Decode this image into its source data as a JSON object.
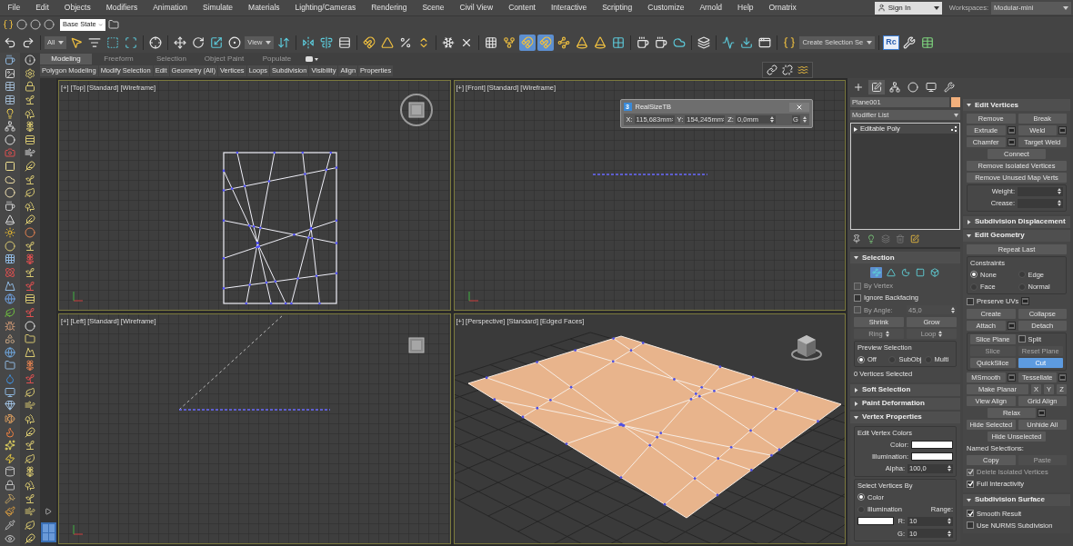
{
  "menu": [
    "File",
    "Edit",
    "Objects",
    "Modifiers",
    "Animation",
    "Simulate",
    "Materials",
    "Lighting/Cameras",
    "Rendering",
    "Scene",
    "Civil View",
    "Content",
    "Interactive",
    "Scripting",
    "Customize",
    "Arnold",
    "Help",
    "Ornatrix"
  ],
  "sign_in": "Sign In",
  "workspaces_label": "Workspaces:",
  "workspace": "Modular-mini",
  "state_set": "Base State",
  "main_toolbar": [
    {
      "kind": "tool",
      "selected": false
    },
    {
      "kind": "tool",
      "selected": false
    },
    {
      "kind": "sep"
    },
    {
      "kind": "dropdown",
      "value": "All"
    },
    {
      "kind": "tool",
      "selected": false
    },
    {
      "kind": "tool",
      "selected": false
    },
    {
      "kind": "tool",
      "selected": false
    },
    {
      "kind": "tool",
      "selected": false
    },
    {
      "kind": "sep"
    },
    {
      "kind": "tool",
      "selected": false
    },
    {
      "kind": "sep"
    },
    {
      "kind": "tool",
      "selected": false
    },
    {
      "kind": "tool",
      "selected": false
    },
    {
      "kind": "tool",
      "selected": false
    },
    {
      "kind": "tool",
      "selected": false
    },
    {
      "kind": "dropdown",
      "value": "View"
    },
    {
      "kind": "tool",
      "selected": false
    },
    {
      "kind": "sep"
    },
    {
      "kind": "tool",
      "selected": false
    },
    {
      "kind": "tool",
      "selected": false
    },
    {
      "kind": "tool",
      "selected": false
    },
    {
      "kind": "sep"
    },
    {
      "kind": "tool",
      "selected": false
    },
    {
      "kind": "tool",
      "selected": false
    },
    {
      "kind": "tool",
      "selected": false
    },
    {
      "kind": "tool",
      "selected": false
    },
    {
      "kind": "sep"
    },
    {
      "kind": "tool",
      "selected": false
    },
    {
      "kind": "tool",
      "selected": false
    },
    {
      "kind": "sep"
    },
    {
      "kind": "tool",
      "selected": false
    },
    {
      "kind": "tool",
      "selected": false
    },
    {
      "kind": "tool",
      "selected": true
    },
    {
      "kind": "tool",
      "selected": true
    },
    {
      "kind": "tool",
      "selected": false
    },
    {
      "kind": "tool",
      "selected": false
    },
    {
      "kind": "tool",
      "selected": false
    },
    {
      "kind": "tool",
      "selected": false
    },
    {
      "kind": "sep"
    },
    {
      "kind": "tool",
      "selected": false
    },
    {
      "kind": "tool",
      "selected": false
    },
    {
      "kind": "tool",
      "selected": false
    },
    {
      "kind": "sep"
    },
    {
      "kind": "tool",
      "selected": false
    },
    {
      "kind": "sep"
    },
    {
      "kind": "tool",
      "selected": false
    },
    {
      "kind": "tool",
      "selected": false
    },
    {
      "kind": "tool",
      "selected": false
    },
    {
      "kind": "sep"
    },
    {
      "kind": "tool",
      "selected": false
    },
    {
      "kind": "dropdown",
      "value": "Create Selection Se"
    },
    {
      "kind": "sep"
    },
    {
      "kind": "badge",
      "label": "Rc"
    },
    {
      "kind": "tool",
      "selected": false
    },
    {
      "kind": "tool",
      "selected": false
    }
  ],
  "ribbon_tabs": [
    {
      "label": "Modeling",
      "selected": true
    },
    {
      "label": "Freeform",
      "selected": false
    },
    {
      "label": "Selection",
      "selected": false
    },
    {
      "label": "Object Paint",
      "selected": false
    },
    {
      "label": "Populate",
      "selected": false
    }
  ],
  "ribbon_groups": [
    "Polygon Modeling",
    "Modify Selection",
    "Edit",
    "Geometry (All)",
    "Vertices",
    "Loops",
    "Subdivision",
    "Visibility",
    "Align",
    "Properties"
  ],
  "viewports": [
    {
      "kind": "top",
      "labels": [
        "[+]",
        "[Top]",
        "[Standard]",
        "[Wireframe]"
      ]
    },
    {
      "kind": "front",
      "labels": [
        "[+]",
        "[Front]",
        "[Standard]",
        "[Wireframe]"
      ]
    },
    {
      "kind": "left",
      "labels": [
        "[+]",
        "[Left]",
        "[Standard]",
        "[Wireframe]"
      ]
    },
    {
      "kind": "perspective",
      "labels": [
        "[+]",
        "[Perspective]",
        "[Standard]",
        "[Edged Faces]"
      ]
    }
  ],
  "realsize": {
    "badge": "3",
    "title": "RealSizeTB",
    "fields": [
      {
        "label": "X:",
        "value": "115,683mm"
      },
      {
        "label": "Y:",
        "value": "154,245mm"
      },
      {
        "label": "Z:",
        "value": "0,0mm"
      }
    ],
    "g": "G"
  },
  "command_panel": {
    "tabs": [
      {
        "selected": false
      },
      {
        "selected": true
      },
      {
        "selected": false
      },
      {
        "selected": false
      },
      {
        "selected": false
      },
      {
        "selected": false
      }
    ],
    "object_name": "Plane001",
    "modifier_list": "Modifier List",
    "stack": [
      {
        "label": "Editable Poly"
      }
    ],
    "left_rollouts": [
      {
        "title": "Selection",
        "expanded": true,
        "rows": [
          [
            {
              "kind": "subobjects",
              "items": [
                {
                  "selected": true
                },
                {
                  "selected": false
                },
                {
                  "selected": false
                },
                {
                  "selected": false
                },
                {
                  "selected": false
                }
              ]
            }
          ],
          [
            {
              "kind": "check",
              "label": "By Vertex",
              "checked": false,
              "disabled": true
            }
          ],
          [
            {
              "kind": "check",
              "label": "Ignore Backfacing",
              "checked": false,
              "disabled": false
            }
          ],
          [
            {
              "kind": "check",
              "label": "By Angle:",
              "checked": false,
              "disabled": true
            },
            {
              "kind": "spinner",
              "value": "45,0",
              "disabled": true
            }
          ],
          [
            {
              "kind": "button",
              "label": "Shrink",
              "disabled": false,
              "selected": false
            },
            {
              "kind": "button",
              "label": "Grow",
              "disabled": false,
              "selected": false
            }
          ],
          [
            {
              "kind": "button",
              "label": "Ring",
              "disabled": true,
              "selected": false,
              "stepper": true
            },
            {
              "kind": "button",
              "label": "Loop",
              "disabled": true,
              "selected": false,
              "stepper": true
            }
          ],
          [
            {
              "kind": "group",
              "title": "Preview Selection",
              "rows": [
                [
                  {
                    "kind": "radio",
                    "label": "Off",
                    "selected": true
                  },
                  {
                    "kind": "radio",
                    "label": "SubObj",
                    "selected": false
                  },
                  {
                    "kind": "radio",
                    "label": "Multi",
                    "selected": false
                  }
                ]
              ]
            }
          ],
          [
            {
              "kind": "text",
              "label": "0 Vertices Selected"
            }
          ]
        ]
      },
      {
        "title": "Soft Selection",
        "expanded": false
      },
      {
        "title": "Paint Deformation",
        "expanded": false
      },
      {
        "title": "Vertex Properties",
        "expanded": true,
        "rows": [
          [
            {
              "kind": "group",
              "title": "Edit Vertex Colors",
              "rows": [
                [
                  {
                    "kind": "swatch",
                    "label": "Color:"
                  }
                ],
                [
                  {
                    "kind": "swatch",
                    "label": "Illumination:"
                  }
                ],
                [
                  {
                    "kind": "spinner",
                    "label": "Alpha:",
                    "value": "100,0",
                    "disabled": false
                  }
                ]
              ]
            }
          ],
          [
            {
              "kind": "group",
              "title": "Select Vertices By",
              "rows": [
                [
                  {
                    "kind": "radio",
                    "label": "Color",
                    "selected": true
                  }
                ],
                [
                  {
                    "kind": "radio",
                    "label": "Illumination",
                    "selected": false
                  },
                  {
                    "kind": "text",
                    "label": "Range:"
                  }
                ],
                [
                  {
                    "kind": "swatch"
                  },
                  {
                    "kind": "spinner",
                    "label": "R:",
                    "value": "10",
                    "disabled": false
                  }
                ],
                [
                  {
                    "kind": "spinner",
                    "label": "G:",
                    "value": "10",
                    "disabled": false
                  }
                ]
              ]
            }
          ]
        ]
      }
    ],
    "right_rollouts": [
      {
        "title": "Edit Vertices",
        "expanded": true,
        "rows": [
          [
            {
              "kind": "button",
              "label": "Remove",
              "disabled": false,
              "selected": false
            },
            {
              "kind": "button",
              "label": "Break",
              "disabled": false,
              "selected": false
            }
          ],
          [
            {
              "kind": "button",
              "label": "Extrude",
              "disabled": false,
              "selected": false,
              "options": true
            },
            {
              "kind": "button",
              "label": "Weld",
              "disabled": false,
              "selected": false,
              "options": true
            }
          ],
          [
            {
              "kind": "button",
              "label": "Chamfer",
              "disabled": false,
              "selected": false,
              "options": true
            },
            {
              "kind": "button",
              "label": "Target Weld",
              "disabled": false,
              "selected": false
            }
          ],
          [
            {
              "kind": "button",
              "label": "Connect",
              "disabled": false,
              "selected": false
            }
          ],
          [
            {
              "kind": "button",
              "label": "Remove Isolated Vertices",
              "disabled": false,
              "selected": false,
              "wide": true
            }
          ],
          [
            {
              "kind": "button",
              "label": "Remove Unused Map Verts",
              "disabled": false,
              "selected": false,
              "wide": true
            }
          ],
          [
            {
              "kind": "group",
              "rows": [
                [
                  {
                    "kind": "spinner",
                    "label": "Weight:",
                    "disabled": false
                  }
                ],
                [
                  {
                    "kind": "spinner",
                    "label": "Crease:",
                    "disabled": false
                  }
                ]
              ]
            }
          ]
        ]
      },
      {
        "title": "Subdivision Displacement",
        "expanded": false
      },
      {
        "title": "Edit Geometry",
        "expanded": true,
        "rows": [
          [
            {
              "kind": "button",
              "label": "Repeat Last",
              "disabled": false,
              "selected": false,
              "wide": true
            }
          ],
          [
            {
              "kind": "group",
              "title": "Constraints",
              "rows": [
                [
                  {
                    "kind": "radio",
                    "label": "None",
                    "selected": true
                  },
                  {
                    "kind": "radio",
                    "label": "Edge",
                    "selected": false
                  }
                ],
                [
                  {
                    "kind": "radio",
                    "label": "Face",
                    "selected": false
                  },
                  {
                    "kind": "radio",
                    "label": "Normal",
                    "selected": false
                  }
                ]
              ]
            }
          ],
          [
            {
              "kind": "check",
              "label": "Preserve UVs",
              "checked": false,
              "disabled": false,
              "options": true
            }
          ],
          [
            {
              "kind": "button",
              "label": "Create",
              "disabled": false,
              "selected": false
            },
            {
              "kind": "button",
              "label": "Collapse",
              "disabled": false,
              "selected": false
            }
          ],
          [
            {
              "kind": "button",
              "label": "Attach",
              "disabled": false,
              "selected": false,
              "options": true
            },
            {
              "kind": "button",
              "label": "Detach",
              "disabled": false,
              "selected": false
            }
          ],
          [
            {
              "kind": "group",
              "rows": [
                [
                  {
                    "kind": "button",
                    "label": "Slice Plane",
                    "disabled": false,
                    "selected": false
                  },
                  {
                    "kind": "check",
                    "label": "Split",
                    "checked": false,
                    "disabled": false
                  }
                ],
                [
                  {
                    "kind": "button",
                    "label": "Slice",
                    "disabled": true,
                    "selected": false
                  },
                  {
                    "kind": "button",
                    "label": "Reset Plane",
                    "disabled": true,
                    "selected": false
                  }
                ],
                [
                  {
                    "kind": "button",
                    "label": "QuickSlice",
                    "disabled": false,
                    "selected": false
                  },
                  {
                    "kind": "button",
                    "label": "Cut",
                    "disabled": false,
                    "selected": true
                  }
                ]
              ]
            }
          ],
          [
            {
              "kind": "button",
              "label": "MSmooth",
              "disabled": false,
              "selected": false,
              "options": true
            },
            {
              "kind": "button",
              "label": "Tessellate",
              "disabled": false,
              "selected": false,
              "options": true
            }
          ],
          [
            {
              "kind": "button",
              "label": "Make Planar",
              "disabled": false,
              "selected": false
            },
            {
              "kind": "button",
              "label": "X",
              "disabled": false,
              "selected": false,
              "narrow": true
            },
            {
              "kind": "button",
              "label": "Y",
              "disabled": false,
              "selected": false,
              "narrow": true
            },
            {
              "kind": "button",
              "label": "Z",
              "disabled": false,
              "selected": false,
              "narrow": true
            }
          ],
          [
            {
              "kind": "button",
              "label": "View Align",
              "disabled": false,
              "selected": false
            },
            {
              "kind": "button",
              "label": "Grid Align",
              "disabled": false,
              "selected": false
            }
          ],
          [
            {
              "kind": "button",
              "label": "Relax",
              "disabled": false,
              "selected": false,
              "options": true
            }
          ],
          [
            {
              "kind": "button",
              "label": "Hide Selected",
              "disabled": false,
              "selected": false
            },
            {
              "kind": "button",
              "label": "Unhide All",
              "disabled": false,
              "selected": false
            }
          ],
          [
            {
              "kind": "button",
              "label": "Hide Unselected",
              "disabled": false,
              "selected": false
            }
          ],
          [
            {
              "kind": "text",
              "label": "Named Selections:"
            }
          ],
          [
            {
              "kind": "button",
              "label": "Copy",
              "disabled": false,
              "selected": false
            },
            {
              "kind": "button",
              "label": "Paste",
              "disabled": true,
              "selected": false
            }
          ],
          [
            {
              "kind": "check",
              "label": "Delete Isolated Vertices",
              "checked": true,
              "disabled": true
            }
          ],
          [
            {
              "kind": "check",
              "label": "Full Interactivity",
              "checked": true,
              "disabled": false
            }
          ]
        ]
      },
      {
        "title": "Subdivision Surface",
        "expanded": true,
        "rows": [
          [
            {
              "kind": "check",
              "label": "Smooth Result",
              "checked": true,
              "disabled": false
            }
          ],
          [
            {
              "kind": "check",
              "label": "Use NURMS Subdivision",
              "checked": false,
              "disabled": false
            }
          ]
        ]
      }
    ]
  }
}
